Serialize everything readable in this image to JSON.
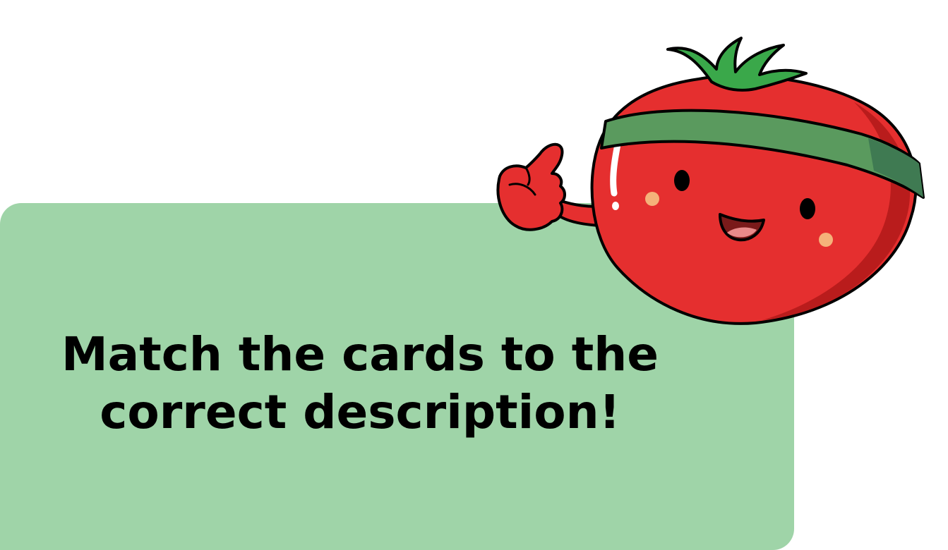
{
  "instruction": {
    "text": "Match the cards to the correct description!"
  },
  "colors": {
    "card_background": "#9fd4a8",
    "tomato_red": "#e52f2f",
    "tomato_shade": "#b91c1c",
    "headband": "#5a9a5e",
    "stem": "#3aa84a",
    "text": "#000000"
  },
  "mascot": {
    "icon": "tomato-mascot-thumbs-up-icon"
  }
}
